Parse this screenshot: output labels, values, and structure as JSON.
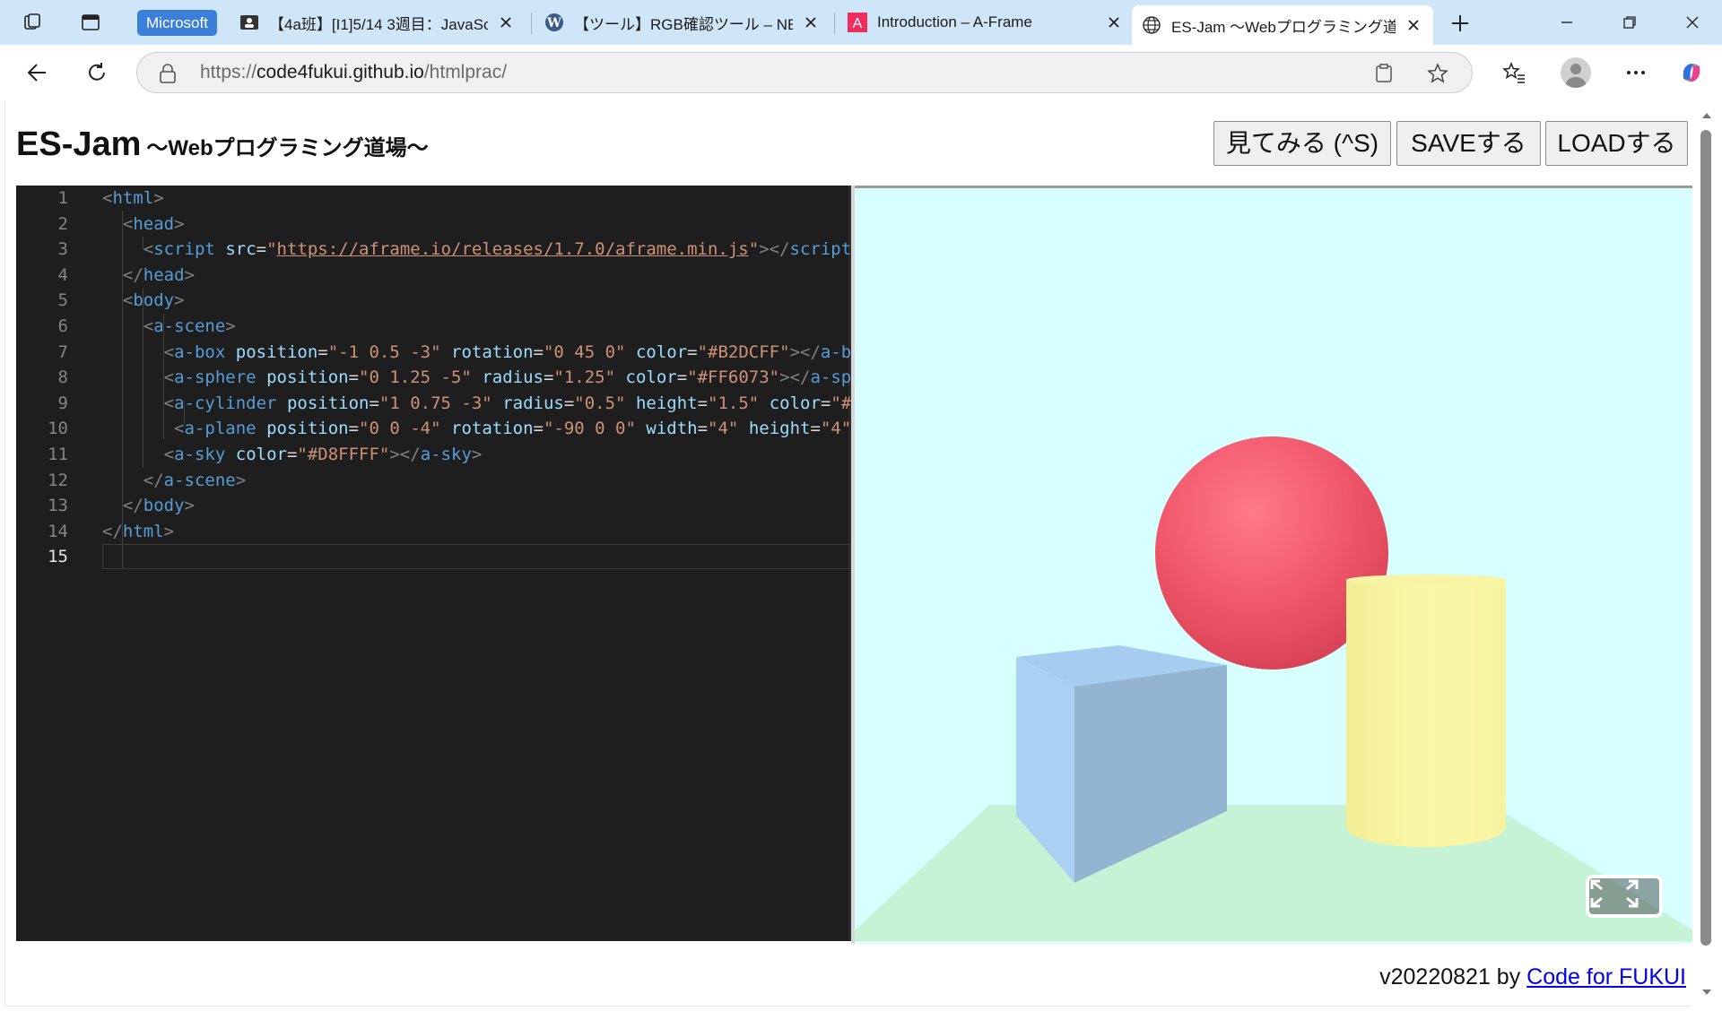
{
  "browser": {
    "group_label": "Microsoft",
    "tabs": [
      {
        "title": "【4a班】[I1]5/14 3週目：JavaScript",
        "icon": "profile-card-icon"
      },
      {
        "title": "【ツール】RGB確認ツール – NEMOTO",
        "icon": "wordpress-icon"
      },
      {
        "title": "Introduction – A-Frame",
        "icon": "aframe-icon"
      },
      {
        "title": "ES-Jam 〜Webプログラミング道場〜",
        "icon": "globe-icon",
        "active": true
      }
    ],
    "url_prefix": "https://",
    "url_host": "code4fukui.github.io",
    "url_path": "/htmlprac/"
  },
  "page": {
    "title": "ES-Jam",
    "subtitle": "〜Webプログラミング道場〜",
    "buttons": {
      "view": "見てみる (^S)",
      "save": "SAVEする",
      "load": "LOADする"
    },
    "footer_version": "v20220821 by ",
    "footer_link": "Code for FUKUI"
  },
  "editor": {
    "line_numbers": [
      "1",
      "2",
      "3",
      "4",
      "5",
      "6",
      "7",
      "8",
      "9",
      "10",
      "11",
      "12",
      "13",
      "14",
      "15"
    ],
    "current_line": 15
  },
  "scene": {
    "sky_color": "#D8FFFF",
    "box_color": "#B2DCFF",
    "sphere_color": "#FF6073",
    "cylinder_color": "#FFF9A8",
    "plane_color": "#C6F2D6"
  }
}
